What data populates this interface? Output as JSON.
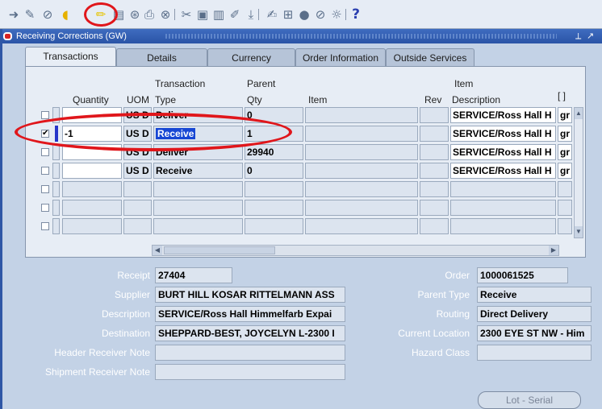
{
  "toolbar": {
    "icons": [
      "arrow-icon",
      "pen-icon",
      "navigator-icon",
      "folder-open-icon",
      "save-icon",
      "search-icon",
      "print-icon",
      "zoom-icon",
      "cut-icon",
      "copy-icon",
      "paste-icon",
      "edit-icon",
      "clear-icon",
      "translate-icon",
      "attachment-icon",
      "folder-icon",
      "delete-icon",
      "paperclip-icon",
      "refresh-icon",
      "help-icon"
    ],
    "help_glyph": "?"
  },
  "window": {
    "title": "Receiving Corrections (GW)",
    "controls": [
      "⟂",
      "↗"
    ]
  },
  "tabs": [
    {
      "label": "Transactions",
      "active": true
    },
    {
      "label": "Details",
      "active": false
    },
    {
      "label": "Currency",
      "active": false
    },
    {
      "label": "Order Information",
      "active": false
    },
    {
      "label": "Outside Services",
      "active": false
    }
  ],
  "table": {
    "headers": {
      "quantity": "Quantity",
      "uom": "UOM",
      "transaction_type_1": "Transaction",
      "transaction_type_2": "Type",
      "parent_qty_1": "Parent",
      "parent_qty_2": "Qty",
      "item": "Item",
      "rev": "Rev",
      "item_desc_1": "Item",
      "item_desc_2": "Description",
      "flex": "[ ]"
    },
    "rows": [
      {
        "checked": false,
        "quantity": "",
        "uom": "US D",
        "type": "Deliver",
        "parent_qty": "0",
        "item": "",
        "rev": "",
        "description": "SERVICE/Ross Hall H",
        "extra": "gr"
      },
      {
        "checked": true,
        "quantity": "-1",
        "uom": "US D",
        "type": "Receive",
        "parent_qty": "1",
        "item": "",
        "rev": "",
        "description": "SERVICE/Ross Hall H",
        "extra": "gr"
      },
      {
        "checked": false,
        "quantity": "",
        "uom": "US D",
        "type": "Deliver",
        "parent_qty": "29940",
        "item": "",
        "rev": "",
        "description": "SERVICE/Ross Hall H",
        "extra": "gr"
      },
      {
        "checked": false,
        "quantity": "",
        "uom": "US D",
        "type": "Receive",
        "parent_qty": "0",
        "item": "",
        "rev": "",
        "description": "SERVICE/Ross Hall H",
        "extra": "gr"
      },
      {
        "checked": false,
        "quantity": "",
        "uom": "",
        "type": "",
        "parent_qty": "",
        "item": "",
        "rev": "",
        "description": "",
        "extra": ""
      },
      {
        "checked": false,
        "quantity": "",
        "uom": "",
        "type": "",
        "parent_qty": "",
        "item": "",
        "rev": "",
        "description": "",
        "extra": ""
      },
      {
        "checked": false,
        "quantity": "",
        "uom": "",
        "type": "",
        "parent_qty": "",
        "item": "",
        "rev": "",
        "description": "",
        "extra": ""
      }
    ]
  },
  "form": {
    "receipt_label": "Receipt",
    "receipt": "27404",
    "supplier_label": "Supplier",
    "supplier": "BURT HILL KOSAR RITTELMANN ASS",
    "description_label": "Description",
    "description": "SERVICE/Ross Hall Himmelfarb Expai",
    "destination_label": "Destination",
    "destination": "SHEPPARD-BEST, JOYCELYN L-2300 I",
    "header_note_label": "Header Receiver Note",
    "header_note": "",
    "shipment_note_label": "Shipment Receiver Note",
    "shipment_note": "",
    "order_label": "Order",
    "order": "1000061525",
    "parent_type_label": "Parent Type",
    "parent_type": "Receive",
    "routing_label": "Routing",
    "routing": "Direct Delivery",
    "current_location_label": "Current Location",
    "current_location": "2300 EYE ST NW - Him",
    "hazard_class_label": "Hazard Class",
    "hazard_class": ""
  },
  "buttons": {
    "lot_serial": "Lot - Serial"
  },
  "colors": {
    "accent_red": "#e0161b",
    "title_blue": "#2a54a6",
    "selection_blue": "#1747d4"
  }
}
